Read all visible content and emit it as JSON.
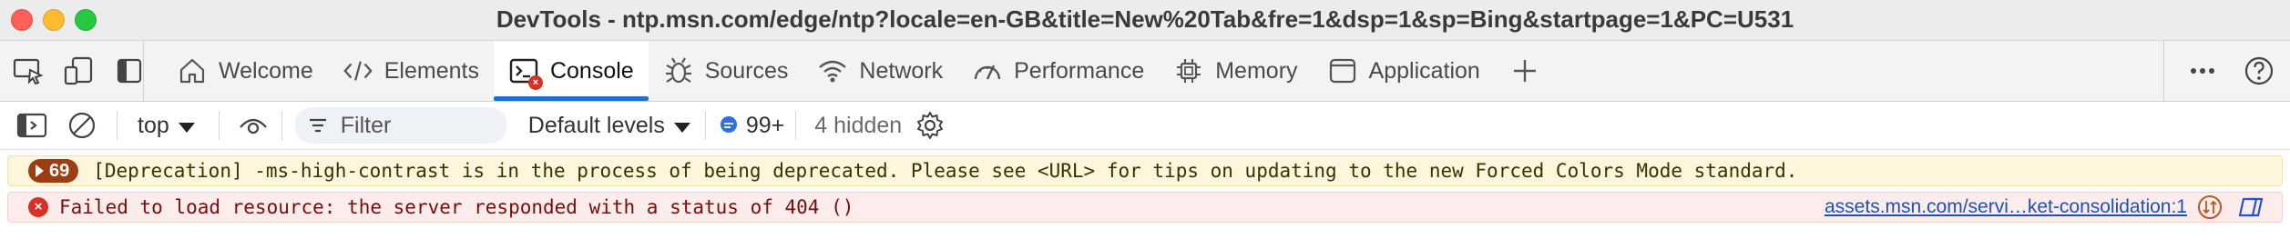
{
  "window": {
    "title": "DevTools - ntp.msn.com/edge/ntp?locale=en-GB&title=New%20Tab&fre=1&dsp=1&sp=Bing&startpage=1&PC=U531"
  },
  "tabs": [
    {
      "label": "Welcome",
      "icon": "home-icon"
    },
    {
      "label": "Elements",
      "icon": "code-icon"
    },
    {
      "label": "Console",
      "icon": "console-icon",
      "active": true
    },
    {
      "label": "Sources",
      "icon": "bug-icon"
    },
    {
      "label": "Network",
      "icon": "wifi-icon"
    },
    {
      "label": "Performance",
      "icon": "gauge-icon"
    },
    {
      "label": "Memory",
      "icon": "chip-icon"
    },
    {
      "label": "Application",
      "icon": "window-icon"
    }
  ],
  "console_toolbar": {
    "context": "top",
    "filter_placeholder": "Filter",
    "levels": "Default levels",
    "issues_count": "99+",
    "hidden": "4 hidden"
  },
  "messages": [
    {
      "type": "warning",
      "count": "69",
      "text": "[Deprecation] -ms-high-contrast is in the process of being deprecated. Please see <URL> for tips on updating to the new Forced Colors Mode standard."
    },
    {
      "type": "error",
      "text": "Failed to load resource: the server responded with a status of 404 ()",
      "source": "assets.msn.com/servi…ket-consolidation:1"
    }
  ],
  "colors": {
    "accent": "#1a6fd1",
    "error": "#d93025",
    "warning_bg": "#fdf6dc",
    "error_bg": "#fcecec",
    "badge": "#9c3d12"
  }
}
